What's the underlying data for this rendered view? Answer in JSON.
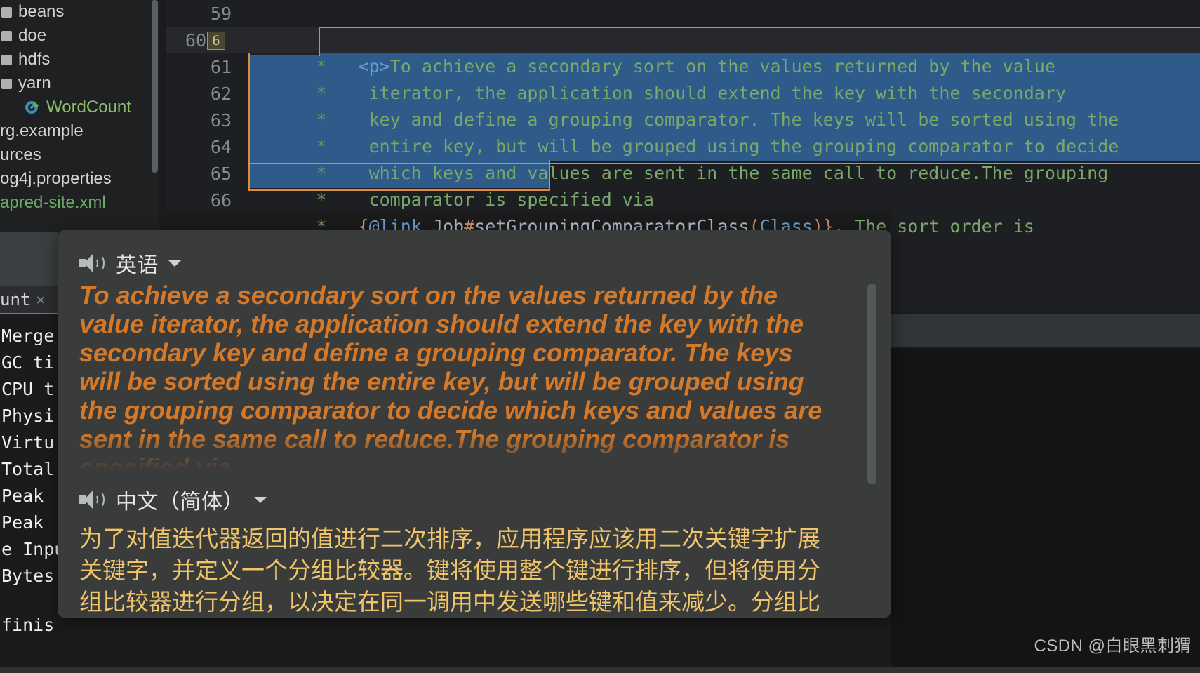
{
  "ide": {
    "project_tree": [
      {
        "icon": "folder-icon",
        "label": "beans",
        "indent": false,
        "kind": "folder"
      },
      {
        "icon": "folder-icon",
        "label": "doe",
        "indent": false,
        "kind": "folder"
      },
      {
        "icon": "folder-icon",
        "label": "hdfs",
        "indent": false,
        "kind": "folder"
      },
      {
        "icon": "folder-icon",
        "label": "yarn",
        "indent": false,
        "kind": "folder"
      },
      {
        "icon": "java-class-run-icon",
        "label": "WordCount",
        "indent": true,
        "kind": "class"
      },
      {
        "icon": "none",
        "label": "rg.example",
        "indent": false,
        "kind": "plain"
      },
      {
        "icon": "none",
        "label": "urces",
        "indent": false,
        "kind": "plain"
      },
      {
        "icon": "none",
        "label": "og4j.properties",
        "indent": false,
        "kind": "plain"
      },
      {
        "icon": "none",
        "label": "apred-site.xml",
        "indent": false,
        "kind": "xml"
      }
    ],
    "gutter": {
      "lines": [
        "59",
        "60",
        "61",
        "62",
        "63",
        "64",
        "65",
        "66"
      ],
      "current_line": "60",
      "badge_value": "6"
    },
    "code_lines": [
      {
        "num": "59",
        "prefix": "*",
        "content": ""
      },
      {
        "num": "60",
        "prefix": "*",
        "content": "  <p>To achieve a secondary sort on the values returned by the value"
      },
      {
        "num": "61",
        "prefix": "*",
        "content": "   iterator, the application should extend the key with the secondary"
      },
      {
        "num": "62",
        "prefix": "*",
        "content": "   key and define a grouping comparator. The keys will be sorted using the"
      },
      {
        "num": "63",
        "prefix": "*",
        "content": "   entire key, but will be grouped using the grouping comparator to decide"
      },
      {
        "num": "64",
        "prefix": "*",
        "content": "   which keys and values are sent in the same call to reduce.The grouping"
      },
      {
        "num": "65",
        "prefix": "*",
        "content": "   comparator is specified via"
      },
      {
        "num": "66",
        "prefix": "*",
        "content": "  {@link Job#setGroupingComparatorClass(Class)}. The sort order is"
      }
    ],
    "code_colors": {
      "comment_green": "#7aa86a",
      "tag_blue": "#679bd6",
      "selection_blue": "#2f5b8a",
      "selection_outline_orange": "#d98d41"
    },
    "console": {
      "tab_label": "unt",
      "tab_close_icon": "close-icon",
      "lines": [
        "Merge",
        "GC ti",
        "CPU t",
        "Physi",
        "Virtu",
        "Total",
        "Peak",
        "Peak",
        "e Inpu",
        "Bytes"
      ],
      "tail_line": "finis"
    }
  },
  "popup": {
    "source": {
      "speaker_icon": "speaker-icon",
      "language": "英语",
      "dropdown_icon": "chevron-down-icon",
      "text": "To achieve a secondary sort on the values returned by the value iterator, the application should extend the key with the secondary key and define a grouping comparator. The keys will be sorted using the entire key, but will be grouped using the grouping comparator to decide which keys and values are sent in the same call to reduce.The grouping comparator is specified via",
      "color": "#d4792a"
    },
    "target": {
      "speaker_icon": "speaker-icon",
      "language": "中文（简体）",
      "dropdown_icon": "chevron-down-icon",
      "text": "为了对值迭代器返回的值进行二次排序，应用程序应该用二次关键字扩展关键字，并定义一个分组比较器。键将使用整个键进行排序，但将使用分组比较器进行分组，以决定在同一调用中发送哪些键和值来减少。分组比较器通过指定",
      "color": "#f0c46a"
    },
    "background": "#3a3c3c"
  },
  "watermark": {
    "text": "CSDN @白眼黑刺猬"
  }
}
